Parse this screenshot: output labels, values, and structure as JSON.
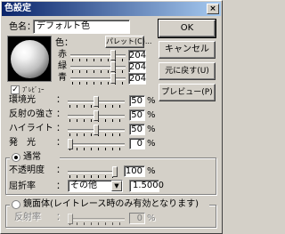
{
  "window": {
    "title": "色設定",
    "close": "×"
  },
  "color_name": {
    "label": "色名：",
    "value": "デフォルト色"
  },
  "color": {
    "label": "色：",
    "palette_button": "パレット(C)...",
    "preview_checkbox": "ﾌﾟﾚﾋﾞｭｰ",
    "preview_checked": true,
    "red": {
      "label": "赤",
      "value": "204"
    },
    "green": {
      "label": "緑",
      "value": "204"
    },
    "blue": {
      "label": "青",
      "value": "204"
    }
  },
  "material": {
    "ambient": {
      "label": "環境光",
      "colon": "：",
      "value": "50",
      "unit": "%"
    },
    "reflect": {
      "label": "反射の強さ",
      "colon": "：",
      "value": "50",
      "unit": "%"
    },
    "highlight": {
      "label": "ハイライト",
      "colon": "：",
      "value": "50",
      "unit": "%"
    },
    "emission": {
      "label": "発　光",
      "colon": "：",
      "value": "0",
      "unit": "%"
    }
  },
  "normal_group": {
    "radio_label": "通常",
    "selected": true,
    "opacity": {
      "label": "不透明度",
      "colon": "：",
      "value": "100",
      "unit": "%"
    },
    "refraction": {
      "label": "屈折率",
      "colon": "：",
      "select_value": "その他",
      "value": "1.5000"
    }
  },
  "mirror_group": {
    "radio_label": "鏡面体(レイトレース時のみ有効となります)",
    "selected": false,
    "reflectance": {
      "label": "反射率",
      "colon": "：",
      "value": "0",
      "unit": "%"
    }
  },
  "buttons": {
    "ok": "OK",
    "cancel": "キャンセル",
    "revert": "元に戻す(U)",
    "preview": "プレビュー(P)"
  },
  "sliders": {
    "red": 0.8,
    "green": 0.8,
    "blue": 0.8,
    "ambient": 0.5,
    "reflect": 0.5,
    "highlight": 0.5,
    "emission": 0.0,
    "opacity": 1.0,
    "reflectance": 0.0
  }
}
